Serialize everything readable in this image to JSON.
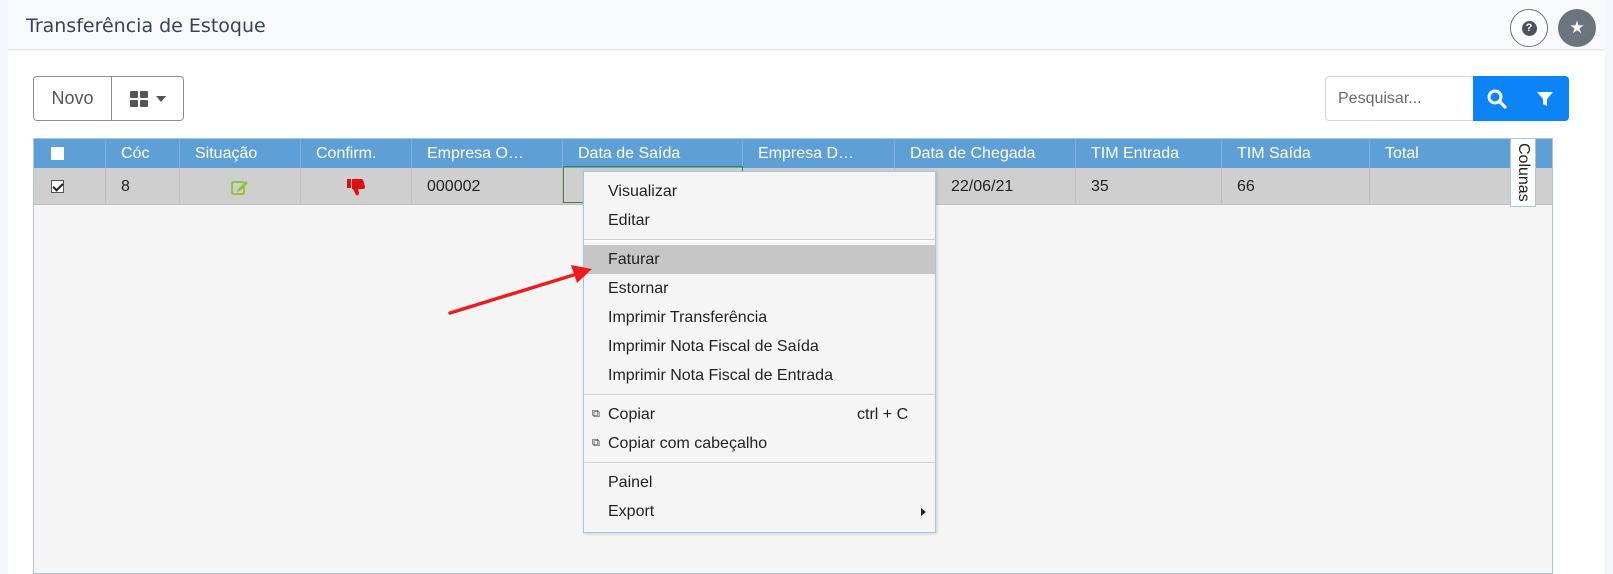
{
  "header": {
    "title": "Transferência de Estoque",
    "help_icon": "question-circle-icon",
    "star_icon": "star-icon",
    "help_glyph": "?",
    "star_glyph": "★"
  },
  "toolbar": {
    "new_label": "Novo",
    "view_icon": "grid-view-icon",
    "search_placeholder": "Pesquisar...",
    "search_icon": "search-icon",
    "filter_icon": "filter-icon",
    "accent_color": "#0d84f5"
  },
  "table": {
    "columns": [
      "Cóc",
      "Situação",
      "Confirm.",
      "Empresa O…",
      "Data de Saída",
      "Empresa D…",
      "Data de Chegada",
      "TIM Entrada",
      "TIM Saída",
      "Total"
    ],
    "rows": [
      {
        "checked": true,
        "codigo": "8",
        "situacao_icon": "edit-icon",
        "confirm_icon": "thumbs-down-icon",
        "empresa_origem": "000002",
        "data_saida": "",
        "empresa_destino": "",
        "data_chegada": "22/06/21",
        "tim_entrada": "35",
        "tim_saida": "66",
        "total": ""
      }
    ],
    "header_color": "#5e9fd6",
    "columns_tab_label": "Colunas"
  },
  "context_menu": {
    "items": [
      {
        "label": "Visualizar"
      },
      {
        "label": "Editar"
      },
      {
        "label": "Faturar",
        "highlighted": true
      },
      {
        "label": "Estornar"
      },
      {
        "label": "Imprimir Transferência"
      },
      {
        "label": "Imprimir Nota Fiscal de Saída"
      },
      {
        "label": "Imprimir Nota Fiscal de Entrada"
      },
      {
        "label": "Copiar",
        "shortcut": "ctrl + C",
        "icon": "copy-icon"
      },
      {
        "label": "Copiar com cabeçalho",
        "icon": "copy-icon"
      },
      {
        "label": "Painel"
      },
      {
        "label": "Export",
        "submenu": true
      }
    ]
  },
  "annotation": {
    "arrow_color": "#ee1c1c"
  }
}
